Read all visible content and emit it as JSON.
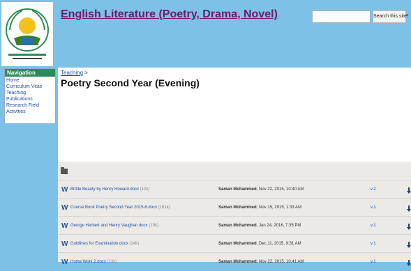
{
  "header": {
    "title": "English Literature (Poetry, Drama, Novel)",
    "search_placeholder": "",
    "search_button": "Search this site",
    "logo_icon": "university-logo-icon"
  },
  "sidebar": {
    "heading": "Navigation",
    "items": [
      {
        "label": "Home"
      },
      {
        "label": "Curriculum Vitae"
      },
      {
        "label": "Teaching"
      },
      {
        "label": "Publications"
      },
      {
        "label": "Research Field"
      },
      {
        "label": "Activities"
      }
    ]
  },
  "main": {
    "breadcrumb_link": "Teaching",
    "breadcrumb_sep": ">",
    "page_title": "Poetry Second Year (Evening)"
  },
  "files": [
    {
      "name": "Brittle Beauty by Henry Howard.docx",
      "size": "(12k)",
      "author": "Saman Mohammed",
      "date": ", Nov 22, 2015, 10:40 AM",
      "version": "v.2"
    },
    {
      "name": "Course Book Poetry Second Year 2015-6.docx",
      "size": "(161k)",
      "author": "Saman Mohammed",
      "date": ", Nov 15, 2015, 1:33 AM",
      "version": "v.1"
    },
    {
      "name": "George Herbert and Henry Vaughan.docx",
      "size": "(19k)",
      "author": "Saman Mohammed",
      "date": ", Jan 24, 2016, 7:35 PM",
      "version": "v.1"
    },
    {
      "name": "Guidlines for Examination.docx",
      "size": "(14k)",
      "author": "Saman Mohammed",
      "date": ", Dec 11, 2015, 9:31 AM",
      "version": "v.1"
    },
    {
      "name": "Home Work 2.docx",
      "size": "(13k)",
      "author": "Saman Mohammed",
      "date": ", Nov 22, 2015, 10:41 AM",
      "version": "v.1"
    }
  ],
  "colors": {
    "header_bg": "#7dc1e6",
    "nav_head": "#2e8b57",
    "link": "#1f4fa3",
    "title": "#6b1b6b"
  }
}
